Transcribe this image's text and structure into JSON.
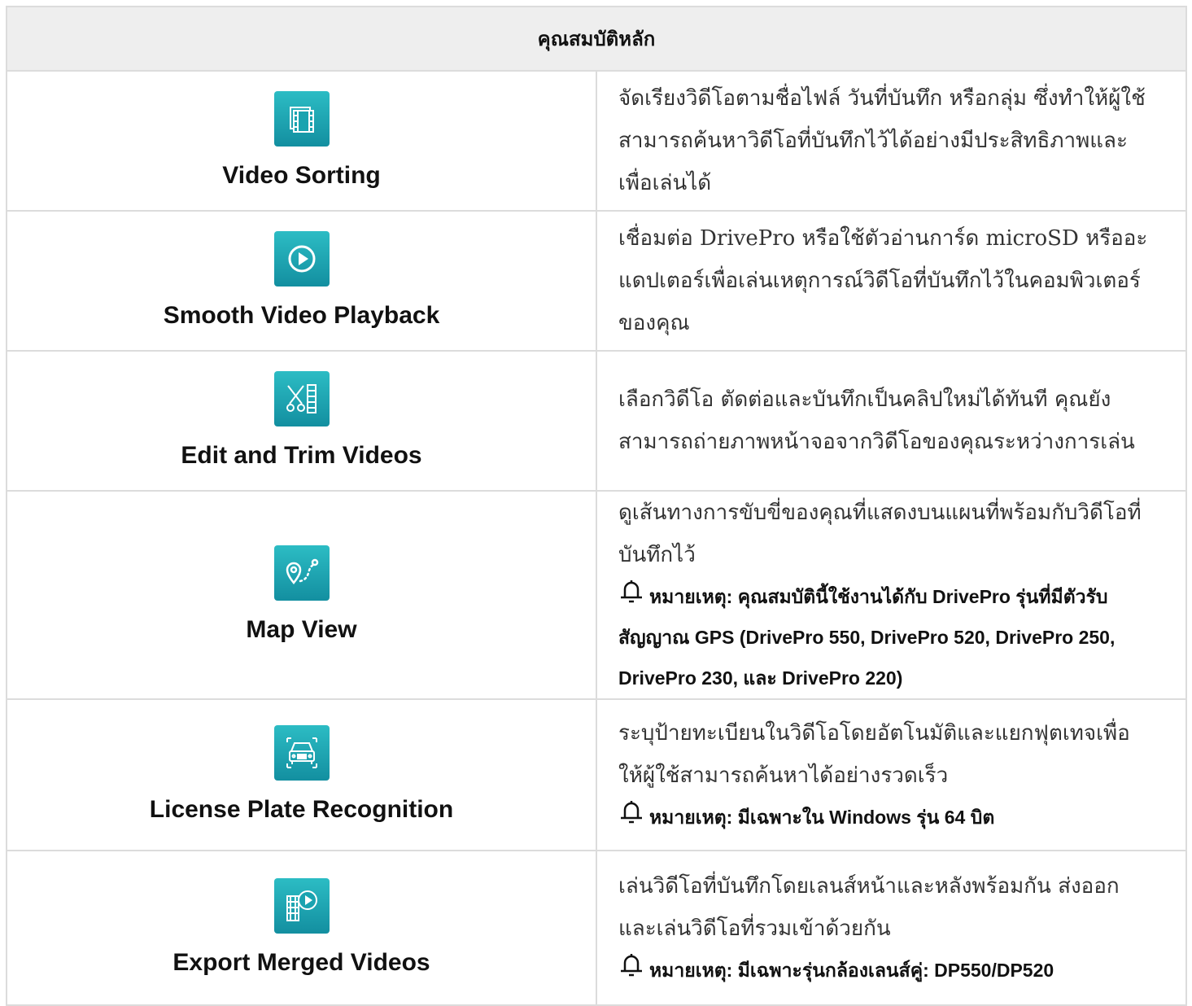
{
  "header": "คุณสมบัติหลัก",
  "features": [
    {
      "icon": "video-sorting-icon",
      "label": "Video Sorting",
      "description": "จัดเรียงวิดีโอตามชื่อไฟล์ วันที่บันทึก หรือกลุ่ม ซึ่งทำให้ผู้ใช้สามารถค้นหาวิดีโอที่บันทึกไว้ได้อย่างมีประสิทธิภาพและเพื่อเล่นได้",
      "note": ""
    },
    {
      "icon": "play-icon",
      "label": "Smooth Video Playback",
      "description": "เชื่อมต่อ DrivePro หรือใช้ตัวอ่านการ์ด microSD หรืออะแดปเตอร์เพื่อเล่นเหตุการณ์วิดีโอที่บันทึกไว้ในคอมพิวเตอร์ของคุณ",
      "note": ""
    },
    {
      "icon": "scissors-film-icon",
      "label": "Edit and Trim Videos",
      "description": "เลือกวิดีโอ ตัดต่อและบันทึกเป็นคลิปใหม่ได้ทันที คุณยังสามารถถ่ายภาพหน้าจอจากวิดีโอของคุณระหว่างการเล่น",
      "note": ""
    },
    {
      "icon": "map-route-icon",
      "label": "Map View",
      "description": "ดูเส้นทางการขับขี่ของคุณที่แสดงบนแผนที่พร้อมกับวิดีโอที่บันทึกไว้",
      "note": "หมายเหตุ: คุณสมบัตินี้ใช้งานได้กับ DrivePro รุ่นที่มีตัวรับสัญญาณ GPS (DrivePro 550, DrivePro 520, DrivePro 250, DrivePro 230, และ DrivePro 220)"
    },
    {
      "icon": "car-plate-icon",
      "label": "License Plate Recognition",
      "description": "ระบุป้ายทะเบียนในวิดีโอโดยอัตโนมัติและแยกฟุตเทจเพื่อให้ผู้ใช้สามารถค้นหาได้อย่างรวดเร็ว",
      "note": "หมายเหตุ: มีเฉพาะใน Windows รุ่น 64 บิต"
    },
    {
      "icon": "merged-videos-icon",
      "label": "Export Merged Videos",
      "description": "เล่นวิดีโอที่บันทึกโดยเลนส์หน้าและหลังพร้อมกัน ส่งออกและเล่นวิดีโอที่รวมเข้าด้วยกัน",
      "note": "หมายเหตุ: มีเฉพาะรุ่นกล้องเลนส์คู่: DP550/DP520"
    }
  ],
  "colors": {
    "icon_top": "#2cbcc4",
    "icon_bottom": "#138fa0",
    "header_bg": "#eeeeee",
    "border": "#dcdcdc"
  }
}
